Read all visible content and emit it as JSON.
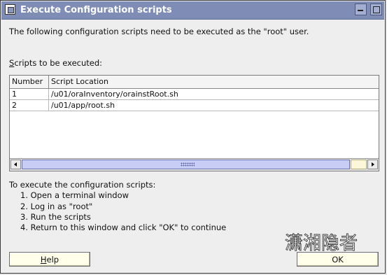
{
  "window": {
    "title": "Execute Configuration scripts"
  },
  "intro_text": "The following configuration scripts need to be executed as the \"root\" user.",
  "scripts_label": {
    "mnemonic": "S",
    "rest": "cripts to be executed:"
  },
  "table": {
    "headers": [
      "Number",
      "Script Location"
    ],
    "rows": [
      {
        "number": "1",
        "location": "/u01/oraInventory/orainstRoot.sh"
      },
      {
        "number": "2",
        "location": "/u01/app/root.sh"
      }
    ]
  },
  "instructions": {
    "heading": "To execute the configuration scripts:",
    "steps": [
      "1. Open a terminal window",
      "2. Log in as \"root\"",
      "3. Run the scripts",
      "4. Return to this window and click \"OK\" to continue"
    ]
  },
  "buttons": {
    "help_mnemonic": "H",
    "help_rest": "elp",
    "ok": "OK"
  },
  "watermark_text": "潇湘隐者",
  "colors": {
    "titlebar": "#7e8cb6",
    "scroll_thumb": "#c7cdf5",
    "button_bg": "#ffffea"
  }
}
